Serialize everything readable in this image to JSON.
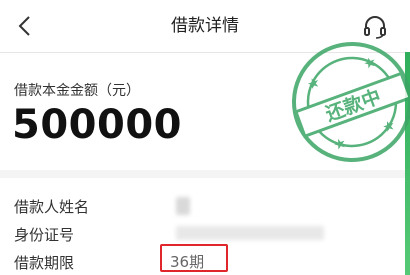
{
  "header": {
    "title": "借款详情"
  },
  "loan": {
    "amount_label": "借款本金金额（元）",
    "amount_value": "500000"
  },
  "stamp": {
    "text": "还款中"
  },
  "details": {
    "borrower_name_label": "借款人姓名",
    "id_number_label": "身份证号",
    "term_label": "借款期限",
    "term_value": "36期"
  },
  "colors": {
    "stamp_green": "#3aa564",
    "highlight_red": "#e0262b"
  },
  "icons": {
    "back": "chevron-left-icon",
    "support": "headset-icon"
  }
}
